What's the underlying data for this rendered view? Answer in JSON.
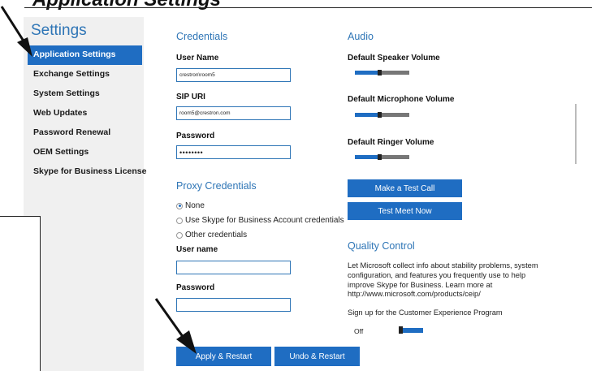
{
  "document": {
    "heading": "Application Settings"
  },
  "sidebar": {
    "title": "Settings",
    "items": [
      {
        "label": "Application Settings",
        "active": true
      },
      {
        "label": "Exchange Settings",
        "active": false
      },
      {
        "label": "System Settings",
        "active": false
      },
      {
        "label": "Web Updates",
        "active": false
      },
      {
        "label": "Password Renewal",
        "active": false
      },
      {
        "label": "OEM Settings",
        "active": false
      },
      {
        "label": "Skype for Business License",
        "active": false
      }
    ]
  },
  "credentials": {
    "title": "Credentials",
    "username_label": "User Name",
    "username_value": "crestron\\room5",
    "sip_label": "SIP URI",
    "sip_value": "room5@crestron.com",
    "password_label": "Password",
    "password_value": "••••••••"
  },
  "proxy": {
    "title": "Proxy Credentials",
    "options": [
      {
        "label": "None",
        "selected": true
      },
      {
        "label": "Use Skype for Business Account credentials",
        "selected": false
      },
      {
        "label": "Other credentials",
        "selected": false
      }
    ],
    "username_label": "User name",
    "username_value": "",
    "password_label": "Password",
    "password_value": ""
  },
  "audio": {
    "title": "Audio",
    "speaker_label": "Default Speaker Volume",
    "speaker_level": 0.45,
    "microphone_label": "Default Microphone Volume",
    "microphone_level": 0.45,
    "ringer_label": "Default Ringer Volume",
    "ringer_level": 0.45
  },
  "buttons": {
    "test_call": "Make a Test Call",
    "test_meet": "Test Meet Now",
    "apply": "Apply & Restart",
    "undo": "Undo & Restart"
  },
  "quality": {
    "title": "Quality Control",
    "description": "Let Microsoft collect info about stability problems, system configuration, and features you frequently use to help improve Skype for Business. Learn more at http://www.microsoft.com/products/ceip/",
    "signup": "Sign up for the Customer Experience Program",
    "toggle_label": "Off",
    "toggle_on": false
  },
  "colors": {
    "accent": "#1f6dc2",
    "title_blue": "#2e75b6",
    "sidebar_bg": "#f0f0f0"
  }
}
